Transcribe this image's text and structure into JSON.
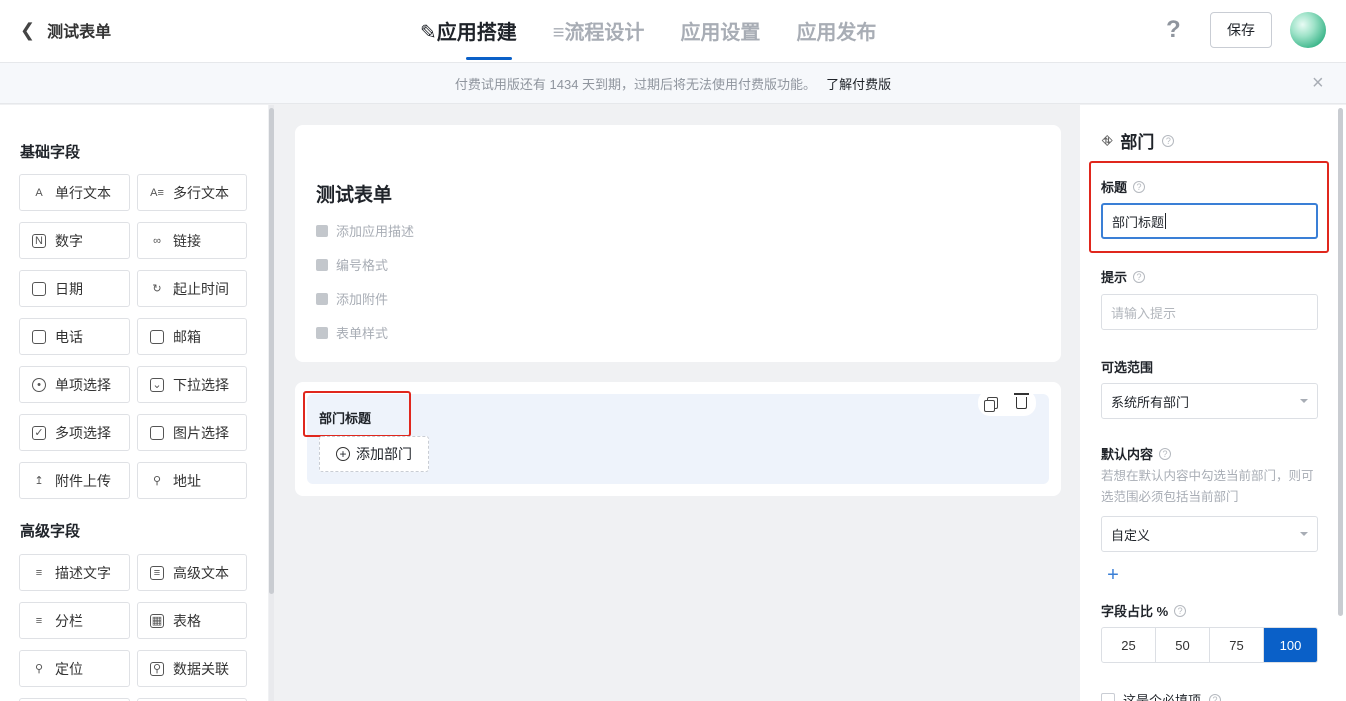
{
  "header": {
    "back_title": "测试表单",
    "tabs": [
      {
        "label": "应用搭建",
        "active": true
      },
      {
        "label": "流程设计",
        "active": false
      },
      {
        "label": "应用设置",
        "active": false
      },
      {
        "label": "应用发布",
        "active": false
      }
    ],
    "help_label": "?",
    "save_label": "保存"
  },
  "notice": {
    "text": "付费试用版还有 1434 天到期，过期后将无法使用付费版功能。",
    "link": "了解付费版",
    "close_label": "×"
  },
  "left_panel": {
    "basic_title": "基础字段",
    "basic_fields": [
      "单行文本",
      "多行文本",
      "数字",
      "链接",
      "日期",
      "起止时间",
      "电话",
      "邮箱",
      "单项选择",
      "下拉选择",
      "多项选择",
      "图片选择",
      "附件上传",
      "地址"
    ],
    "advanced_title": "高级字段",
    "advanced_fields": [
      "描述文字",
      "高级文本",
      "分栏",
      "表格",
      "定位",
      "数据关联"
    ]
  },
  "canvas": {
    "form_title": "测试表单",
    "options": [
      "添加应用描述",
      "编号格式",
      "添加附件",
      "表单样式"
    ],
    "field": {
      "title": "部门标题",
      "add_label": "添加部门"
    }
  },
  "properties": {
    "type_title": "部门",
    "title_label": "标题",
    "title_value": "部门标题",
    "hint_label": "提示",
    "hint_placeholder": "请输入提示",
    "range_label": "可选范围",
    "range_value": "系统所有部门",
    "default_label": "默认内容",
    "default_hint": "若想在默认内容中勾选当前部门，则可选范围必须包括当前部门",
    "default_value": "自定义",
    "ratio_label": "字段占比 %",
    "ratio_options": [
      "25",
      "50",
      "75",
      "100"
    ],
    "ratio_selected": "100",
    "required_label": "这是个必填项"
  },
  "colors": {
    "accent": "#0a60c8",
    "highlight_box": "#e0271d"
  }
}
